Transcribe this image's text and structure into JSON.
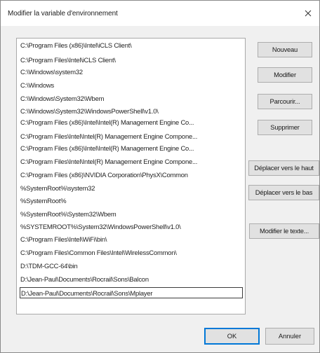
{
  "window": {
    "title": "Modifier la variable d'environnement",
    "close_icon": "close-icon"
  },
  "paths": [
    "C:\\Program Files (x86)\\Intel\\iCLS Client\\",
    "C:\\Program Files\\Intel\\iCLS Client\\",
    "C:\\Windows\\system32",
    "C:\\Windows",
    "C:\\Windows\\System32\\Wbem",
    "C:\\Windows\\System32\\WindowsPowerShell\\v1.0\\",
    "C:\\Program Files (x86)\\Intel\\Intel(R) Management Engine Co...",
    "C:\\Program Files\\Intel\\Intel(R) Management Engine Compone...",
    "C:\\Program Files (x86)\\Intel\\Intel(R) Management Engine Co...",
    "C:\\Program Files\\Intel\\Intel(R) Management Engine Compone...",
    "C:\\Program Files (x86)\\NVIDIA Corporation\\PhysX\\Common",
    "%SystemRoot%\\system32",
    "%SystemRoot%",
    "%SystemRoot%\\System32\\Wbem",
    "%SYSTEMROOT%\\System32\\WindowsPowerShell\\v1.0\\",
    "C:\\Program Files\\Intel\\WiFi\\bin\\",
    "C:\\Program Files\\Common Files\\Intel\\WirelessCommon\\",
    "D:\\TDM-GCC-64\\bin",
    "D:\\Jean-Paul\\Documents\\Rocrail\\Sons\\Balcon",
    "D:\\Jean-Paul\\Documents\\Rocrail\\Sons\\Mplayer"
  ],
  "selected_index": 19,
  "buttons": {
    "new": "Nouveau",
    "edit": "Modifier",
    "browse": "Parcourir...",
    "delete": "Supprimer",
    "move_up": "Déplacer vers le haut",
    "move_down": "Déplacer vers le bas",
    "edit_text": "Modifier le texte...",
    "ok": "OK",
    "cancel": "Annuler"
  },
  "colors": {
    "dialog_bg": "#f0f0f0",
    "button_bg": "#e1e1e1",
    "default_button_border": "#0078d7"
  }
}
